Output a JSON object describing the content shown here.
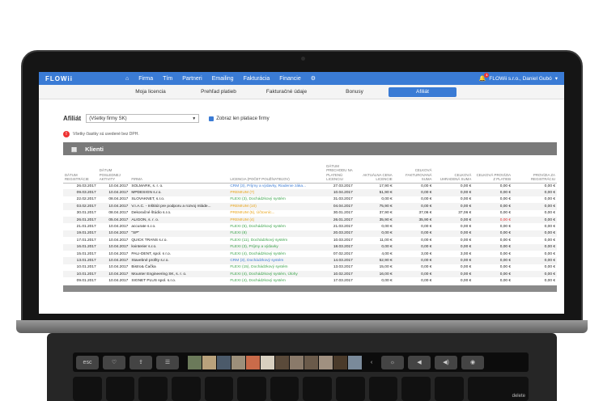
{
  "app": {
    "logo": "FLOWii"
  },
  "nav": {
    "home_icon": "home-icon",
    "items": [
      "Firma",
      "Tím",
      "Partneri",
      "Emailing",
      "Fakturácia",
      "Financie"
    ],
    "settings_icon": "gear-icon",
    "notification_count": "1",
    "user": "FLOWii s.r.o., Daniel Gubó"
  },
  "tabs": [
    "Moja licencia",
    "Prehľad platieb",
    "Fakturačné údaje",
    "Bonusy",
    "Afiliát"
  ],
  "active_tab": "Afiliát",
  "filter": {
    "label": "Afiliát",
    "select_value": "(Všetky firmy SK)",
    "checkbox_label": "Zobraz len platiace firmy"
  },
  "note": {
    "icon": "!",
    "text": "Všetky čiastky sú uvedené bez DPH."
  },
  "section": {
    "title": "Klienti"
  },
  "table": {
    "headers": [
      "DÁTUM REGISTRÁCIE",
      "DÁTUM POSLEDNEJ AKTIVITY",
      "FIRMA",
      "LICENCIA (POČET POUŽÍVATEĽOV)",
      "DÁTUM PRECHODU NA PLATENÚ LICENCIU",
      "AKTUÁLNA CENA LICENCIE",
      "CELKOVÁ FAKTUROVANÁ SUMA",
      "CELKOVÁ UHRADENÁ SUMA",
      "CELKOVÁ PROVÍZIA Z PLATIEB",
      "PROVÍZIA ZA REGISTRÁCIU"
    ],
    "rows": [
      {
        "reg": "26.03.2017",
        "act": "10.04.2017",
        "firm": "SOLMARK, s. r. o.",
        "lic": "CRM (3), Príjmy a výdavky, Riadenie záka...",
        "lic_color": "blue",
        "pay": "27.03.2017",
        "price": "17,90 €",
        "inv": "0,00 €",
        "paid": "0,00 €",
        "prov": "0,00 €",
        "preg": "0,00 €",
        "prov_red": false
      },
      {
        "reg": "09.03.2017",
        "act": "10.04.2017",
        "firm": "MPDESIGN s.r.o.",
        "lic": "PREMIUM (7)",
        "lic_color": "orange",
        "pay": "10.04.2017",
        "price": "51,90 €",
        "inv": "0,00 €",
        "paid": "0,00 €",
        "prov": "0,00 €",
        "preg": "0,00 €",
        "prov_red": false
      },
      {
        "reg": "22.02.2017",
        "act": "08.04.2017",
        "firm": "SLOVAKNET, s.r.o.",
        "lic": "FLEXI (3), Dochádzkový systém",
        "lic_color": "green",
        "pay": "31.03.2017",
        "price": "0,00 €",
        "inv": "0,00 €",
        "paid": "0,00 €",
        "prov": "0,00 €",
        "preg": "0,00 €",
        "prov_red": false
      },
      {
        "reg": "03.02.2017",
        "act": "10.04.2017",
        "firm": "V.I.A.C. - Inštitút pre podporu a rozvoj mláde...",
        "lic": "PREMIUM (10)",
        "lic_color": "orange",
        "pay": "04.04.2017",
        "price": "75,90 €",
        "inv": "0,00 €",
        "paid": "0,00 €",
        "prov": "0,00 €",
        "preg": "0,00 €",
        "prov_red": false
      },
      {
        "reg": "30.01.2017",
        "act": "08.04.2017",
        "firm": "Dekoračné štúdio s.r.o.",
        "lic": "PREMIUM (5), Účtovníc...",
        "lic_color": "orange",
        "pay": "30.01.2017",
        "price": "37,90 €",
        "inv": "37,06 €",
        "paid": "37,06 €",
        "prov": "0,00 €",
        "preg": "0,00 €",
        "prov_red": false
      },
      {
        "reg": "26.01.2017",
        "act": "05.04.2017",
        "firm": "ALIGON, s. r. o.",
        "lic": "PREMIUM (4)",
        "lic_color": "orange",
        "pay": "26.01.2017",
        "price": "35,90 €",
        "inv": "35,90 €",
        "paid": "0,00 €",
        "prov": "0,00 €",
        "preg": "0,00 €",
        "prov_red": true
      },
      {
        "reg": "21.01.2017",
        "act": "10.04.2017",
        "firm": "accurate s.r.o.",
        "lic": "FLEXI (5), Dochádzkový systém",
        "lic_color": "green",
        "pay": "21.03.2017",
        "price": "0,00 €",
        "inv": "0,00 €",
        "paid": "0,00 €",
        "prov": "0,00 €",
        "preg": "0,00 €",
        "prov_red": false
      },
      {
        "reg": "19.01.2017",
        "act": "10.04.2017",
        "firm": "\"SP\"",
        "lic": "FLEXI (8)",
        "lic_color": "green",
        "pay": "20.03.2017",
        "price": "0,00 €",
        "inv": "0,00 €",
        "paid": "0,00 €",
        "prov": "0,00 €",
        "preg": "0,00 €",
        "prov_red": false
      },
      {
        "reg": "17.01.2017",
        "act": "10.04.2017",
        "firm": "QUICK TRANS s.r.o.",
        "lic": "FLEXI (11), Dochádzkový systém",
        "lic_color": "green",
        "pay": "10.03.2017",
        "price": "11,00 €",
        "inv": "0,00 €",
        "paid": "0,00 €",
        "prov": "0,00 €",
        "preg": "0,00 €",
        "prov_red": false
      },
      {
        "reg": "16.01.2017",
        "act": "10.04.2017",
        "firm": "kvinterier s.r.o.",
        "lic": "FLEXI (3), Príjmy a výdavky",
        "lic_color": "green",
        "pay": "18.03.2017",
        "price": "0,00 €",
        "inv": "0,00 €",
        "paid": "0,00 €",
        "prov": "0,00 €",
        "preg": "0,00 €",
        "prov_red": false
      },
      {
        "reg": "15.01.2017",
        "act": "10.04.2017",
        "firm": "PALI-DENT, spol. s r.o.",
        "lic": "FLEXI (4), Dochádzkový systém",
        "lic_color": "green",
        "pay": "07.02.2017",
        "price": "4,00 €",
        "inv": "3,00 €",
        "paid": "3,00 €",
        "prov": "0,00 €",
        "preg": "0,00 €",
        "prov_red": false
      },
      {
        "reg": "13.01.2017",
        "act": "10.04.2017",
        "firm": "Stavebné profity s.r.o.",
        "lic": "CRM (3), Dochádzkový systém",
        "lic_color": "blue",
        "pay": "14.03.2017",
        "price": "52,90 €",
        "inv": "0,00 €",
        "paid": "0,00 €",
        "prov": "0,00 €",
        "preg": "0,00 €",
        "prov_red": false
      },
      {
        "reg": "10.01.2017",
        "act": "10.04.2017",
        "firm": "Bistro& Čačka",
        "lic": "FLEXI (15), Dochádzkový systém",
        "lic_color": "green",
        "pay": "13.03.2017",
        "price": "15,00 €",
        "inv": "0,00 €",
        "paid": "0,00 €",
        "prov": "0,00 €",
        "preg": "0,00 €",
        "prov_red": false
      },
      {
        "reg": "10.01.2017",
        "act": "10.04.2017",
        "firm": "Mounter Engineering SK, s. r. o.",
        "lic": "FLEXI (4), Dochádzkový systém, Úlohy",
        "lic_color": "green",
        "pay": "10.02.2017",
        "price": "16,00 €",
        "inv": "0,00 €",
        "paid": "0,00 €",
        "prov": "0,00 €",
        "preg": "0,00 €",
        "prov_red": false
      },
      {
        "reg": "09.01.2017",
        "act": "10.04.2017",
        "firm": "SIGNET PLUS spol. s.r.o.",
        "lic": "FLEXI (4), Dochádzkový systém",
        "lic_color": "green",
        "pay": "17.03.2017",
        "price": "0,00 €",
        "inv": "0,00 €",
        "paid": "0,00 €",
        "prov": "0,00 €",
        "preg": "0,00 €",
        "prov_red": false
      }
    ]
  },
  "keyboard": {
    "esc": "esc",
    "delete": "delete"
  },
  "colors": {
    "accent": "#3a7bd5",
    "green": "#3aa34a",
    "orange": "#e8a317",
    "red": "#d33333"
  }
}
